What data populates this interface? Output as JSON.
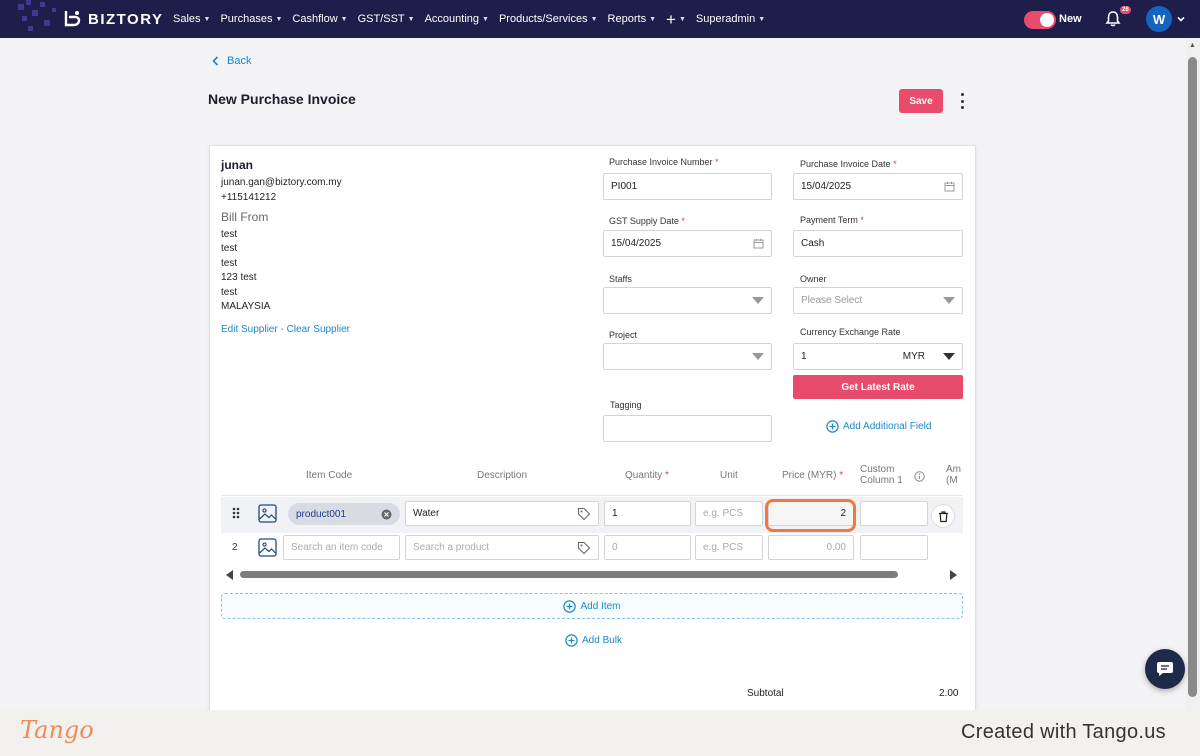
{
  "app": {
    "brand": "BIZTORY"
  },
  "nav": {
    "items": [
      {
        "label": "Sales"
      },
      {
        "label": "Purchases"
      },
      {
        "label": "Cashflow"
      },
      {
        "label": "GST/SST"
      },
      {
        "label": "Accounting"
      },
      {
        "label": "Products/Services"
      },
      {
        "label": "Reports"
      },
      {
        "label": "+"
      },
      {
        "label": "Superadmin"
      }
    ],
    "toggle_label": "New",
    "notification_count": "26",
    "avatar_initial": "W"
  },
  "header": {
    "back_label": "Back",
    "title": "New Purchase Invoice",
    "save_label": "Save"
  },
  "supplier": {
    "name": "junan",
    "email": "junan.gan@biztory.com.my",
    "phone": "+115141212",
    "bill_from_label": "Bill From",
    "address_lines": [
      "test",
      "test",
      "test",
      "123 test",
      "test",
      "MALAYSIA"
    ],
    "edit_link": "Edit Supplier",
    "separator": " - ",
    "clear_link": "Clear Supplier"
  },
  "form": {
    "invoice_number": {
      "label": "Purchase Invoice Number",
      "value": "PI001"
    },
    "invoice_date": {
      "label": "Purchase Invoice Date",
      "value": "15/04/2025"
    },
    "gst_supply_date": {
      "label": "GST Supply Date",
      "value": "15/04/2025"
    },
    "payment_term": {
      "label": "Payment Term",
      "value": "Cash"
    },
    "staffs": {
      "label": "Staffs",
      "value": ""
    },
    "owner": {
      "label": "Owner",
      "placeholder": "Please Select"
    },
    "project": {
      "label": "Project",
      "value": ""
    },
    "currency_rate": {
      "label": "Currency Exchange Rate",
      "rate": "1",
      "currency": "MYR"
    },
    "get_rate_label": "Get Latest Rate",
    "tagging": {
      "label": "Tagging",
      "value": ""
    },
    "add_field_label": "Add Additional Field",
    "required_mark": "*"
  },
  "table": {
    "headers": {
      "item_code": "Item Code",
      "description": "Description",
      "quantity": "Quantity",
      "unit": "Unit",
      "price": "Price (MYR)",
      "custom_1": "Custom",
      "custom_2": "Column 1",
      "amount_1": "Am",
      "amount_2": "(M"
    },
    "rows": [
      {
        "item_code": "product001",
        "description": "Water",
        "quantity": "1",
        "unit_placeholder": "e.g. PCS",
        "price": "2"
      },
      {
        "number": "2",
        "item_code_placeholder": "Search an item code",
        "description_placeholder": "Search a product",
        "quantity_placeholder": "0",
        "unit_placeholder": "e.g. PCS",
        "price_placeholder": "0.00"
      }
    ],
    "add_item_label": "Add Item",
    "add_bulk_label": "Add Bulk"
  },
  "totals": {
    "subtotal_label": "Subtotal",
    "subtotal_value": "2.00"
  },
  "footer": {
    "logo": "Tango",
    "credit": "Created with Tango.us"
  },
  "colors": {
    "nav_bg": "#1e1e4a",
    "accent": "#e94b6c",
    "link": "#1e88c8",
    "highlight": "#f07a3c"
  }
}
